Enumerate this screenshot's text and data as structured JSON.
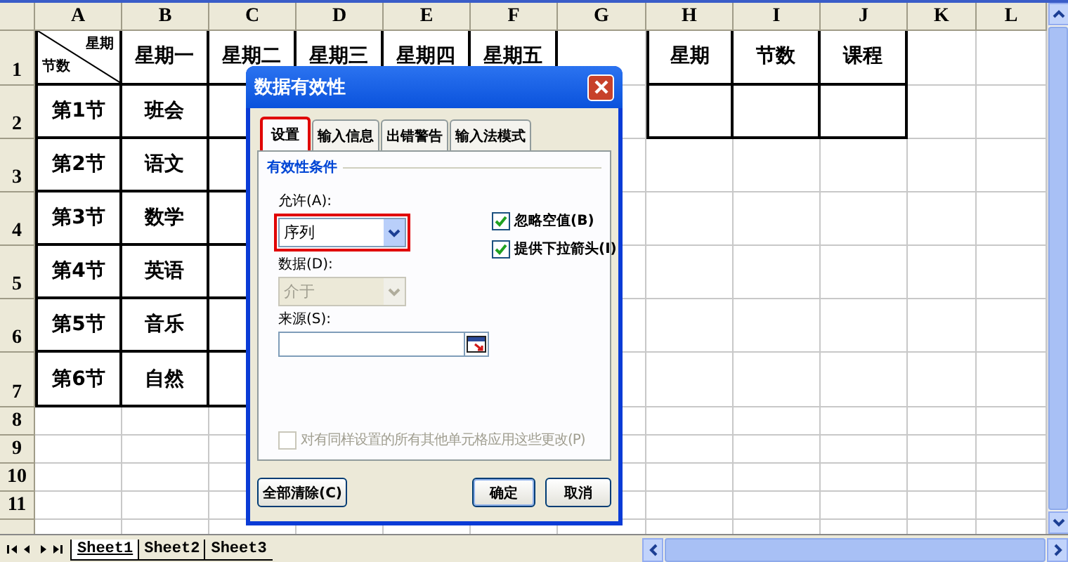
{
  "sheet": {
    "columns": [
      "A",
      "B",
      "C",
      "D",
      "E",
      "F",
      "G",
      "H",
      "I",
      "J",
      "K",
      "L"
    ],
    "corner": {
      "top": "星期",
      "bottom": "节数"
    },
    "rows": [
      {
        "number": "1",
        "cells": {
          "B": "星期一",
          "C": "星期二",
          "D": "星期三",
          "E": "星期四",
          "F": "星期五",
          "H": "星期",
          "I": "节数",
          "J": "课程"
        }
      },
      {
        "number": "2",
        "cells": {
          "A": "第1节",
          "B": "班会"
        }
      },
      {
        "number": "3",
        "cells": {
          "A": "第2节",
          "B": "语文"
        }
      },
      {
        "number": "4",
        "cells": {
          "A": "第3节",
          "B": "数学"
        }
      },
      {
        "number": "5",
        "cells": {
          "A": "第4节",
          "B": "英语"
        }
      },
      {
        "number": "6",
        "cells": {
          "A": "第5节",
          "B": "音乐"
        }
      },
      {
        "number": "7",
        "cells": {
          "A": "第6节",
          "B": "自然"
        }
      },
      {
        "number": "8"
      },
      {
        "number": "9"
      },
      {
        "number": "10"
      },
      {
        "number": "11"
      }
    ],
    "sheet_tabs": [
      {
        "label": "Sheet1",
        "selected": true
      },
      {
        "label": "Sheet2",
        "selected": false
      },
      {
        "label": "Sheet3",
        "selected": false
      }
    ]
  },
  "dialog": {
    "title": "数据有效性",
    "tabs": [
      {
        "label": "设置",
        "selected": true,
        "highlighted": true
      },
      {
        "label": "输入信息",
        "selected": false,
        "highlighted": false
      },
      {
        "label": "出错警告",
        "selected": false,
        "highlighted": false
      },
      {
        "label": "输入法模式",
        "selected": false,
        "highlighted": false
      }
    ],
    "group_title": "有效性条件",
    "allow": {
      "label": "允许(A):",
      "value": "序列",
      "highlighted": true,
      "disabled": false
    },
    "data": {
      "label": "数据(D):",
      "value": "介于",
      "disabled": true
    },
    "source": {
      "label": "来源(S):"
    },
    "checkboxes": [
      {
        "label": "忽略空值(B)",
        "checked": true
      },
      {
        "label": "提供下拉箭头(I)",
        "checked": true
      }
    ],
    "apply_all": {
      "label": "对有同样设置的所有其他单元格应用这些更改(P)",
      "checked": false,
      "disabled": true
    },
    "buttons": [
      {
        "label": "全部清除(C)",
        "kind": "left"
      },
      {
        "label": "确定",
        "kind": "default"
      },
      {
        "label": "取消",
        "kind": "normal"
      }
    ]
  }
}
